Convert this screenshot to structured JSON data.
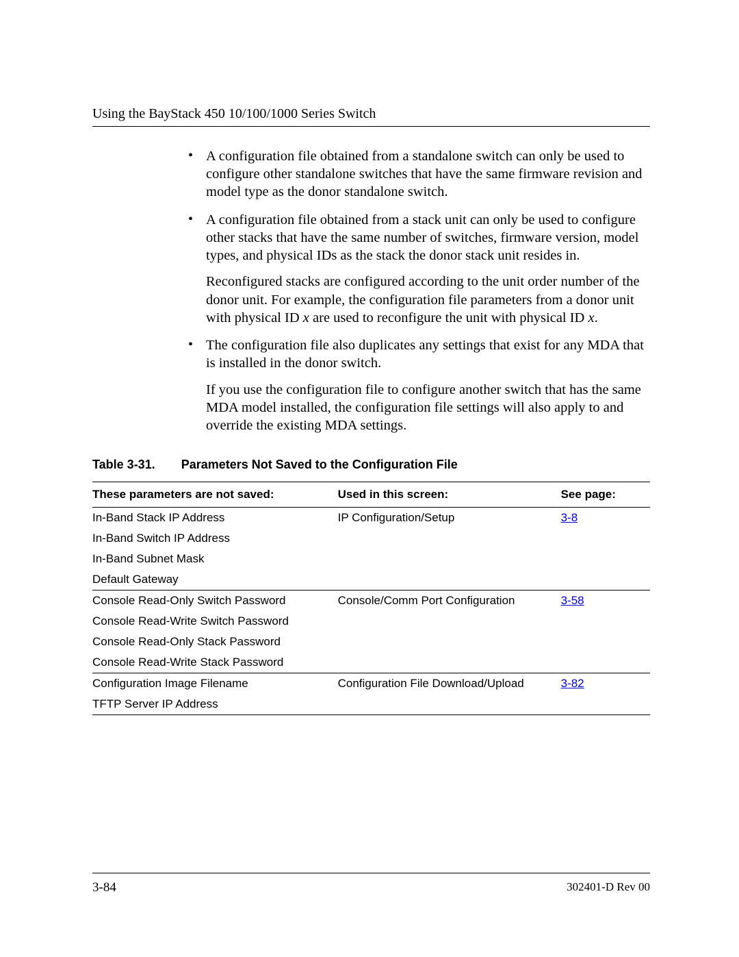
{
  "header": "Using the BayStack 450 10/100/1000 Series Switch",
  "bullets": [
    {
      "text": "A configuration file obtained from a standalone switch can only be used to configure other standalone switches that have the same firmware revision and model type as the donor standalone switch.",
      "extra": []
    },
    {
      "text": "A configuration file obtained from a stack unit can only be used to configure other stacks that have the same number of switches, firmware version, model types, and physical IDs as the stack the donor stack unit resides in.",
      "extra": [
        {
          "plain1": "Reconfigured stacks are configured according to the unit order number of the donor unit. For example, the configuration file parameters from a donor unit with physical ID ",
          "it1": "x",
          "plain2": " are used to reconfigure the unit with physical ID ",
          "it2": "x",
          "plain3": "."
        }
      ]
    },
    {
      "text": "The configuration file also duplicates any settings that exist for any MDA that is installed in the donor switch.",
      "extra": [
        {
          "plain1": "If you use the configuration file to configure another switch that has the same MDA model installed, the configuration file settings will also apply to and override the existing MDA settings.",
          "it1": "",
          "plain2": "",
          "it2": "",
          "plain3": ""
        }
      ]
    }
  ],
  "table": {
    "label": "Table 3-31.",
    "title": "Parameters Not Saved to the Configuration File",
    "headers": {
      "param": "These parameters are not saved:",
      "screen": "Used in this screen:",
      "page": "See page:"
    },
    "rows": [
      {
        "param": "In-Band Stack IP Address",
        "screen": "IP Configuration/Setup",
        "page": "3-8",
        "sep": false
      },
      {
        "param": "In-Band Switch IP Address",
        "screen": "",
        "page": "",
        "sep": false
      },
      {
        "param": "In-Band Subnet Mask",
        "screen": "",
        "page": "",
        "sep": false
      },
      {
        "param": "Default Gateway",
        "screen": "",
        "page": "",
        "sep": false
      },
      {
        "param": "Console Read-Only Switch Password",
        "screen": "Console/Comm Port Configuration",
        "page": "3-58",
        "sep": true
      },
      {
        "param": "Console Read-Write Switch Password",
        "screen": "",
        "page": "",
        "sep": false
      },
      {
        "param": "Console Read-Only Stack Password",
        "screen": "",
        "page": "",
        "sep": false
      },
      {
        "param": "Console Read-Write Stack Password",
        "screen": "",
        "page": "",
        "sep": false
      },
      {
        "param": "Configuration Image Filename",
        "screen": "Configuration File Download/Upload",
        "page": "3-82",
        "sep": true
      },
      {
        "param": "TFTP Server IP Address",
        "screen": "",
        "page": "",
        "sep": false
      }
    ]
  },
  "footer": {
    "left": "3-84",
    "right": "302401-D Rev 00"
  }
}
